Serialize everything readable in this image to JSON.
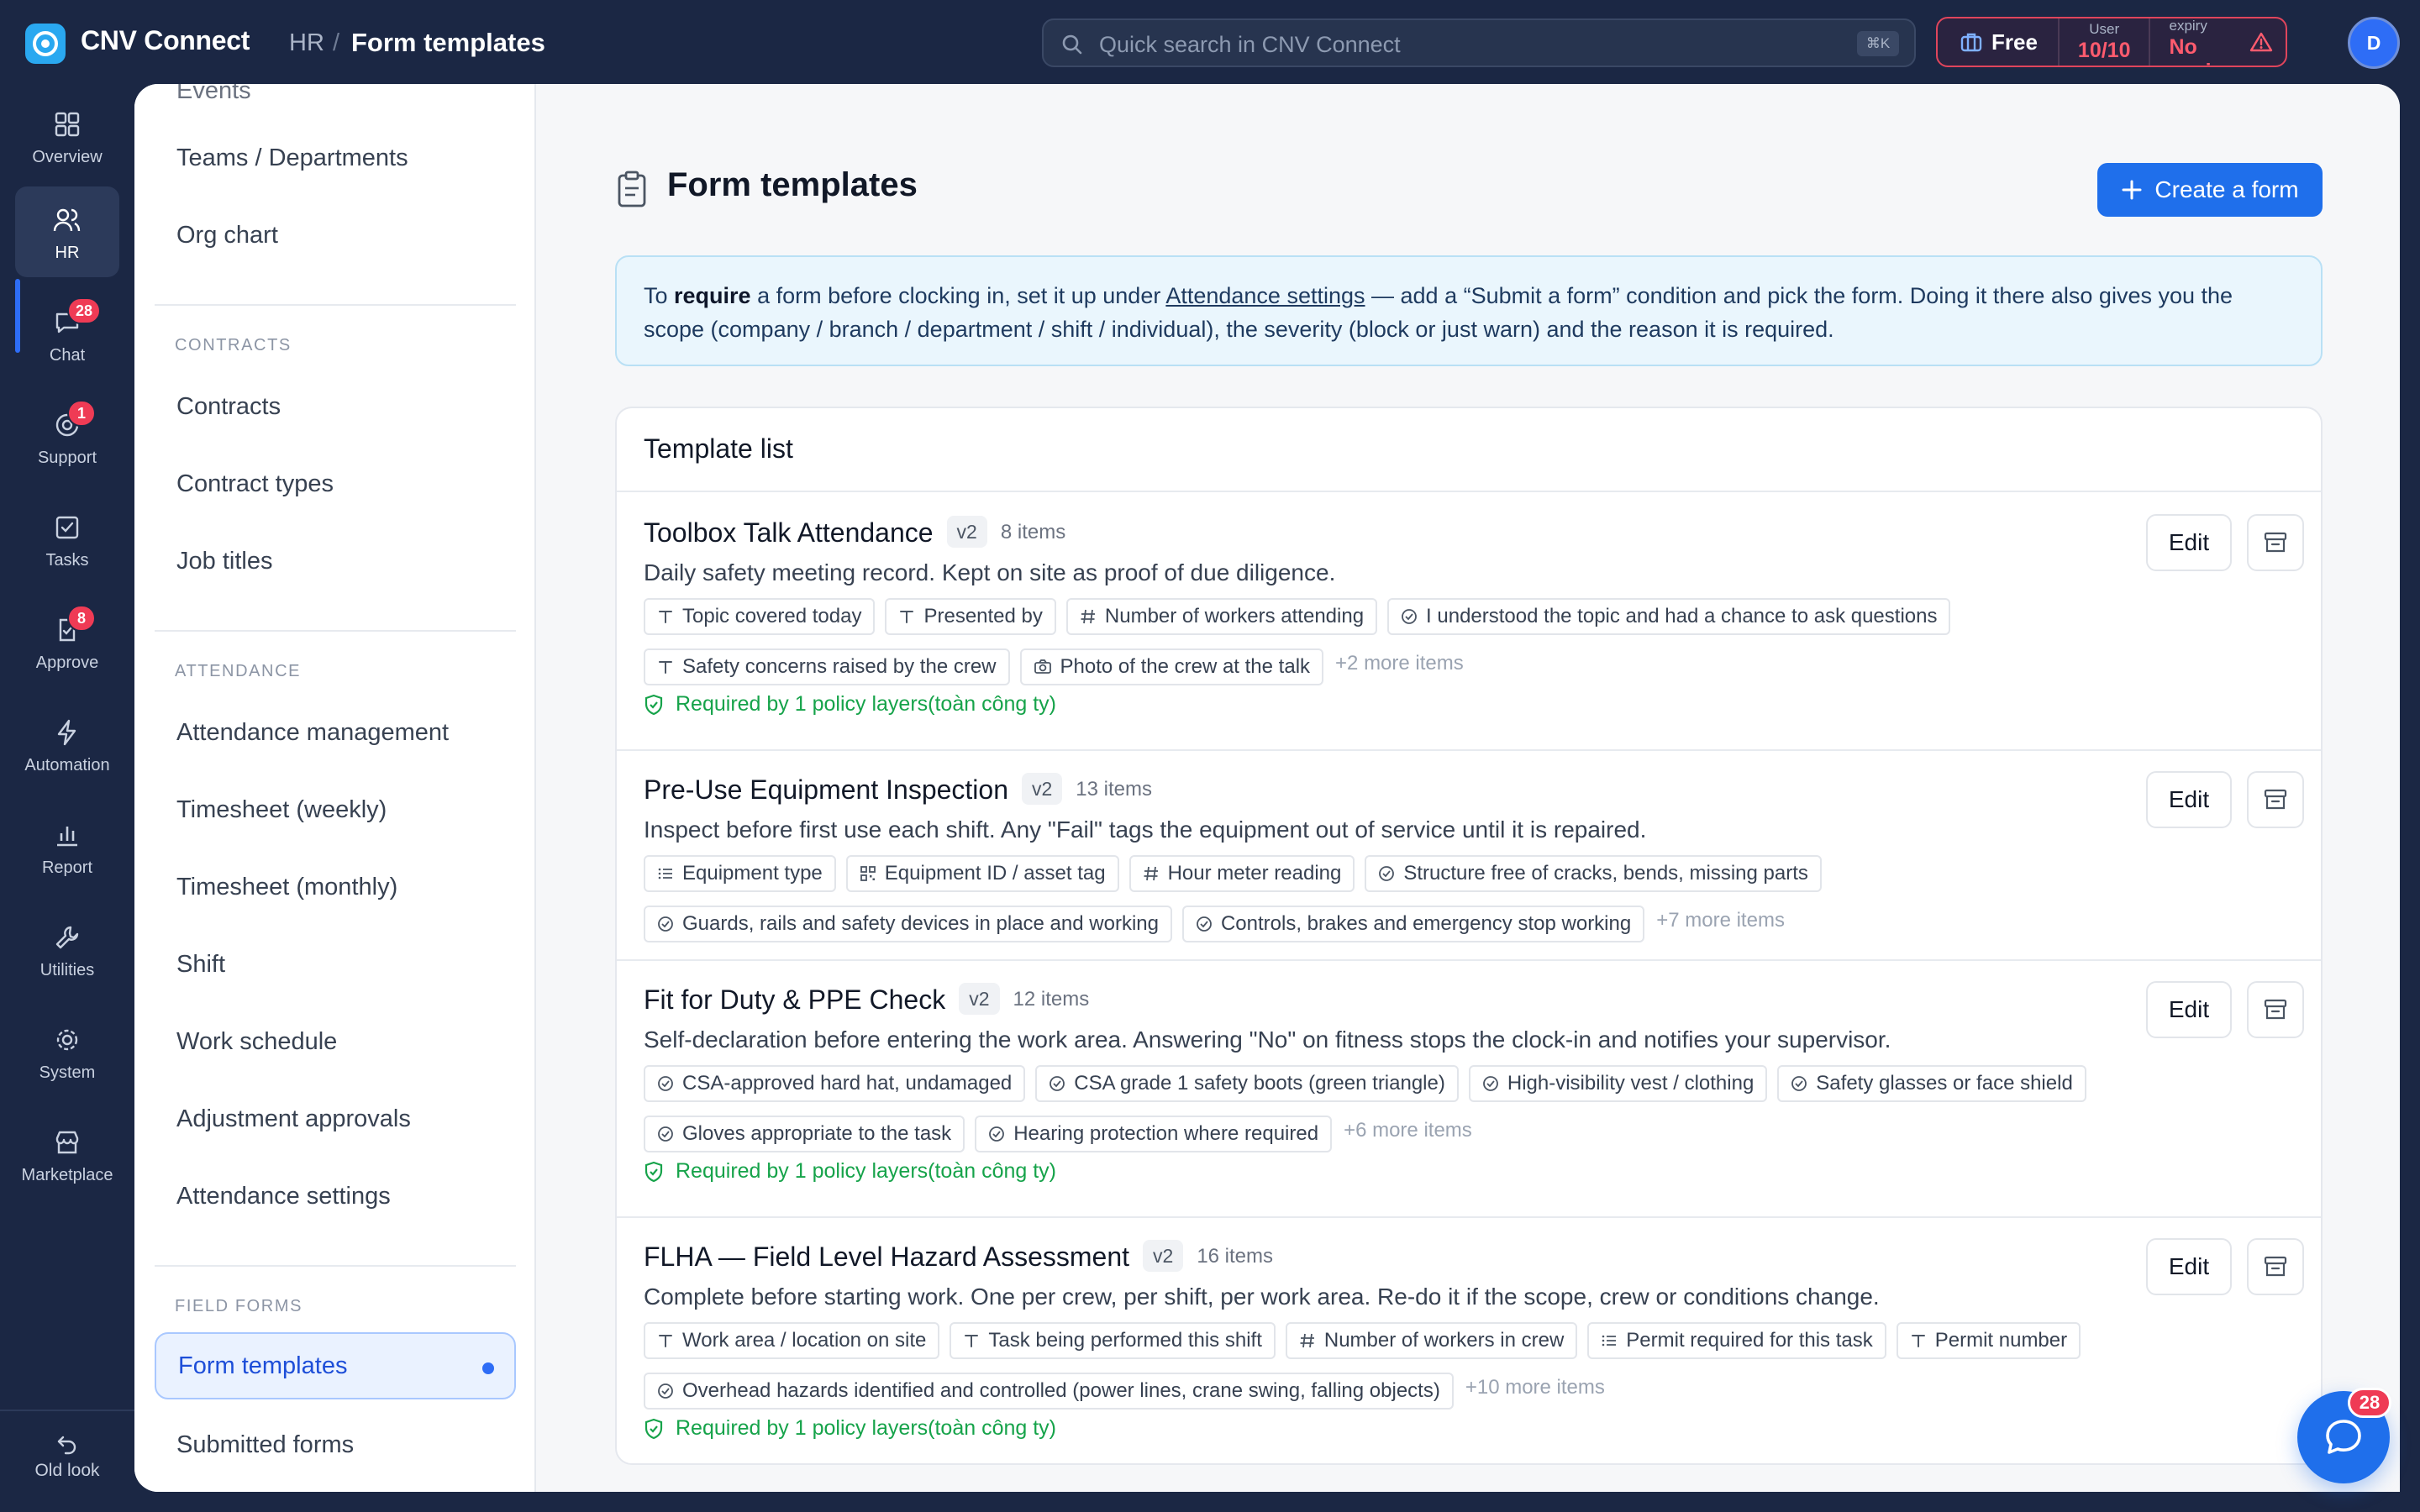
{
  "app": {
    "name": "CNV Connect"
  },
  "breadcrumb": {
    "section": "HR",
    "separator": "/",
    "current": "Form templates"
  },
  "search": {
    "placeholder": "Quick search in CNV Connect",
    "shortcut": "⌘K"
  },
  "plan": {
    "tier": "Free",
    "user_label": "User",
    "user_value": "10/10",
    "expiry_label": "Plan expiry",
    "expiry_value": "No expiry"
  },
  "user": {
    "avatar_initial": "D"
  },
  "rail": {
    "items": [
      {
        "label": "Overview",
        "icon": "grid-icon"
      },
      {
        "label": "HR",
        "icon": "users-icon",
        "active": true
      },
      {
        "label": "Chat",
        "icon": "chat-icon",
        "badge": "28"
      },
      {
        "label": "Support",
        "icon": "support-icon",
        "badge": "1"
      },
      {
        "label": "Tasks",
        "icon": "checkbox-icon"
      },
      {
        "label": "Approve",
        "icon": "approve-icon",
        "badge": "8"
      },
      {
        "label": "Automation",
        "icon": "bolt-icon"
      },
      {
        "label": "Report",
        "icon": "bar-chart-icon"
      },
      {
        "label": "Utilities",
        "icon": "wrench-icon"
      },
      {
        "label": "System",
        "icon": "gear-icon"
      },
      {
        "label": "Marketplace",
        "icon": "store-icon"
      }
    ],
    "old_look": "Old look"
  },
  "subnav": {
    "top_cut": "Events",
    "group0": [
      "Teams / Departments",
      "Org chart"
    ],
    "contracts_header": "CONTRACTS",
    "contracts": [
      "Contracts",
      "Contract types",
      "Job titles"
    ],
    "attendance_header": "ATTENDANCE",
    "attendance": [
      "Attendance management",
      "Timesheet (weekly)",
      "Timesheet (monthly)",
      "Shift",
      "Work schedule",
      "Adjustment approvals",
      "Attendance settings"
    ],
    "field_forms_header": "FIELD FORMS",
    "field_forms": [
      {
        "label": "Form templates",
        "active": true
      },
      {
        "label": "Submitted forms"
      }
    ]
  },
  "page": {
    "title": "Form templates",
    "create_button": "Create a form"
  },
  "info": {
    "p1": "To ",
    "strong": "require",
    "p2": " a form before clocking in, set it up under ",
    "link": "Attendance settings",
    "p3": " — add a “Submit a form” condition and pick the form. Doing it there also gives you the scope (company / branch / department / shift / individual), the severity (block or just warn) and the reason it is required."
  },
  "list": {
    "title": "Template list",
    "edit_label": "Edit",
    "templates": [
      {
        "name": "Toolbox Talk Attendance",
        "version": "v2",
        "count": "8 items",
        "description": "Daily safety meeting record. Kept on site as proof of due diligence.",
        "chips": [
          {
            "icon": "text-icon",
            "label": "Topic covered today"
          },
          {
            "icon": "text-icon",
            "label": "Presented by"
          },
          {
            "icon": "hash-icon",
            "label": "Number of workers attending"
          },
          {
            "icon": "check-circle-icon",
            "label": "I understood the topic and had a chance to ask questions"
          },
          {
            "icon": "text-icon",
            "label": "Safety concerns raised by the crew"
          },
          {
            "icon": "camera-icon",
            "label": "Photo of the crew at the talk"
          }
        ],
        "more": "+2 more items",
        "policy": "Required by 1 policy layers(toàn công ty)"
      },
      {
        "name": "Pre-Use Equipment Inspection",
        "version": "v2",
        "count": "13 items",
        "description": "Inspect before first use each shift. Any \"Fail\" tags the equipment out of service until it is repaired.",
        "chips": [
          {
            "icon": "list-icon",
            "label": "Equipment type"
          },
          {
            "icon": "qr-icon",
            "label": "Equipment ID / asset tag"
          },
          {
            "icon": "hash-icon",
            "label": "Hour meter reading"
          },
          {
            "icon": "check-circle-icon",
            "label": "Structure free of cracks, bends, missing parts"
          },
          {
            "icon": "check-circle-icon",
            "label": "Guards, rails and safety devices in place and working"
          },
          {
            "icon": "check-circle-icon",
            "label": "Controls, brakes and emergency stop working"
          }
        ],
        "more": "+7 more items",
        "policy": ""
      },
      {
        "name": "Fit for Duty & PPE Check",
        "version": "v2",
        "count": "12 items",
        "description": "Self-declaration before entering the work area. Answering \"No\" on fitness stops the clock-in and notifies your supervisor.",
        "chips": [
          {
            "icon": "check-circle-icon",
            "label": "CSA-approved hard hat, undamaged"
          },
          {
            "icon": "check-circle-icon",
            "label": "CSA grade 1 safety boots (green triangle)"
          },
          {
            "icon": "check-circle-icon",
            "label": "High-visibility vest / clothing"
          },
          {
            "icon": "check-circle-icon",
            "label": "Safety glasses or face shield"
          },
          {
            "icon": "check-circle-icon",
            "label": "Gloves appropriate to the task"
          },
          {
            "icon": "check-circle-icon",
            "label": "Hearing protection where required"
          }
        ],
        "more": "+6 more items",
        "policy": "Required by 1 policy layers(toàn công ty)"
      },
      {
        "name": "FLHA — Field Level Hazard Assessment",
        "version": "v2",
        "count": "16 items",
        "description": "Complete before starting work. One per crew, per shift, per work area. Re-do it if the scope, crew or conditions change.",
        "chips": [
          {
            "icon": "text-icon",
            "label": "Work area / location on site"
          },
          {
            "icon": "text-icon",
            "label": "Task being performed this shift"
          },
          {
            "icon": "hash-icon",
            "label": "Number of workers in crew"
          },
          {
            "icon": "list-icon",
            "label": "Permit required for this task"
          },
          {
            "icon": "text-icon",
            "label": "Permit number"
          },
          {
            "icon": "check-circle-icon",
            "label": "Overhead hazards identified and controlled (power lines, crane swing, falling objects)"
          }
        ],
        "more": "+10 more items",
        "policy": "Required by 1 policy layers(toàn công ty)"
      }
    ]
  },
  "chat_fab": {
    "badge": "28"
  },
  "colors": {
    "accent": "#1f6feb",
    "sidebar": "#1b2744",
    "danger": "#ef3b55",
    "success": "#16a34a"
  }
}
